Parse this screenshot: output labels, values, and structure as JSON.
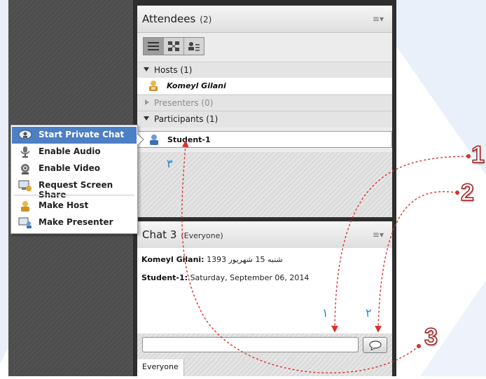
{
  "attendees": {
    "title": "Attendees",
    "count": "(2)",
    "groups": [
      {
        "label": "Hosts (1)"
      },
      {
        "label": "Presenters (0)"
      },
      {
        "label": "Participants (1)"
      }
    ],
    "hosts": [
      {
        "name": "Komeyl Gilani"
      }
    ],
    "participants": [
      {
        "name": "Student-1"
      }
    ]
  },
  "chat": {
    "title": "Chat 3",
    "scope": "(Everyone)",
    "messages": [
      {
        "sender": "Komeyl Gilani:",
        "text": "شنبه 15 شهریور 1393"
      },
      {
        "sender": "Student-1:",
        "text": "Saturday, September 06, 2014"
      }
    ],
    "input_value": "",
    "tab_label": "Everyone"
  },
  "context_menu": {
    "items": [
      {
        "label": "Start Private Chat",
        "icon": "private-chat-icon"
      },
      {
        "label": "Enable Audio",
        "icon": "microphone-icon"
      },
      {
        "label": "Enable Video",
        "icon": "webcam-icon"
      },
      {
        "label": "Request Screen Share",
        "icon": "screen-share-icon"
      },
      {
        "label": "Make Host",
        "icon": "host-icon"
      },
      {
        "label": "Make Presenter",
        "icon": "presenter-icon"
      }
    ]
  },
  "annotations": {
    "persian_labels": [
      "۳",
      "۱",
      "۲"
    ],
    "numbers": [
      "1",
      "2",
      "3"
    ]
  },
  "colors": {
    "annotation_arrow": "#d9302c",
    "menu_highlight": "#4d7fc4",
    "persian_label": "#1f86c6"
  }
}
